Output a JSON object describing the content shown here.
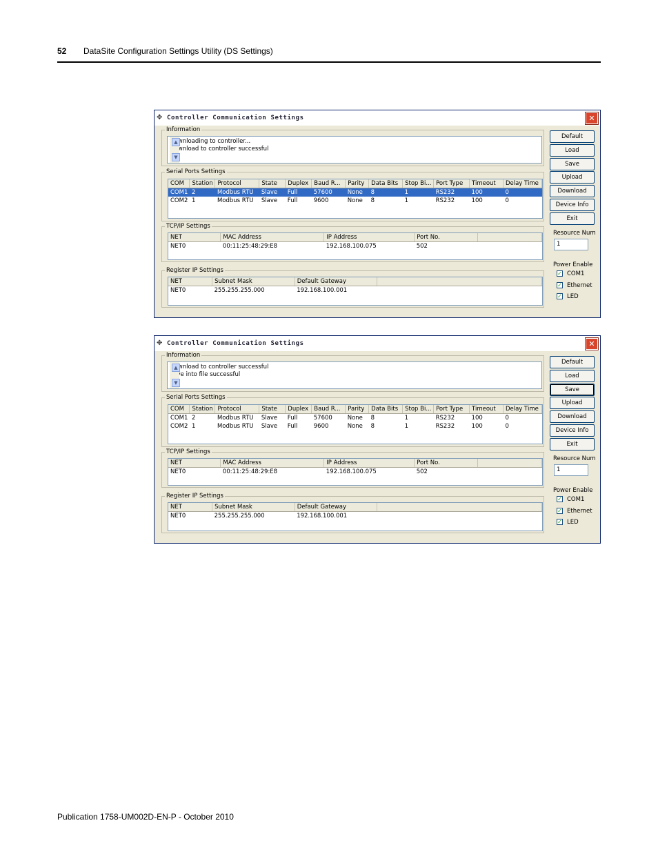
{
  "page": {
    "number": "52",
    "header_title": "DataSite Configuration Settings Utility (DS Settings)",
    "footer": "Publication 1758-UM002D-EN-P - October 2010"
  },
  "dialog_common": {
    "title": "Controller Communication Settings",
    "close_glyph": "✕",
    "info_label": "Information",
    "serial_label": "Serial Ports Settings",
    "tcpip_label": "TCP/IP Settings",
    "register_label": "Register IP Settings",
    "serial_columns": [
      "COM",
      "Station",
      "Protocol",
      "State",
      "Duplex",
      "Baud R...",
      "Parity",
      "Data Bits",
      "Stop Bi...",
      "Port Type",
      "Timeout",
      "Delay Time"
    ],
    "serial_rows": [
      [
        "COM1",
        "2",
        "Modbus RTU",
        "Slave",
        "Full",
        "57600",
        "None",
        "8",
        "1",
        "RS232",
        "100",
        "0"
      ],
      [
        "COM2",
        "1",
        "Modbus RTU",
        "Slave",
        "Full",
        "9600",
        "None",
        "8",
        "1",
        "RS232",
        "100",
        "0"
      ]
    ],
    "tcpip_columns": [
      "NET",
      "MAC Address",
      "IP Address",
      "Port No."
    ],
    "tcpip_rows": [
      [
        "NET0",
        "00:11:25:48:29:E8",
        "192.168.100.075",
        "502"
      ]
    ],
    "register_columns": [
      "NET",
      "Subnet Mask",
      "Default Gateway"
    ],
    "register_rows": [
      [
        "NET0",
        "255.255.255.000",
        "192.168.100.001"
      ]
    ],
    "buttons": [
      "Default",
      "Load",
      "Save",
      "Upload",
      "Download",
      "Device Info",
      "Exit"
    ],
    "resource_label": "Resource Num",
    "resource_value": "1",
    "power_label": "Power Enable",
    "power_options": [
      {
        "label": "COM1",
        "checked": true
      },
      {
        "label": "Ethernet",
        "checked": true
      },
      {
        "label": "LED",
        "checked": true
      }
    ],
    "scroll_up_glyph": "▲",
    "scroll_down_glyph": "▼"
  },
  "dialogs": [
    {
      "info_lines": [
        "Downloading to controller...",
        "Download to controller successful"
      ],
      "selected_serial_row": 0,
      "focused_button": ""
    },
    {
      "info_lines": [
        "Download to controller successful",
        "Save into file successful"
      ],
      "selected_serial_row": -1,
      "focused_button": "Save"
    }
  ]
}
